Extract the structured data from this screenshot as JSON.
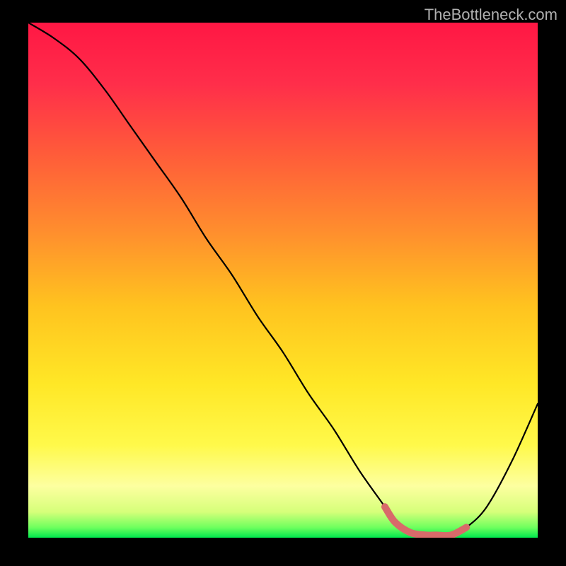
{
  "watermark": "TheBottleneck.com",
  "chart_data": {
    "type": "line",
    "title": "",
    "xlabel": "",
    "ylabel": "",
    "xlim": [
      0,
      100
    ],
    "ylim": [
      0,
      100
    ],
    "series": [
      {
        "name": "bottleneck-curve",
        "x": [
          0,
          5,
          10,
          15,
          20,
          25,
          30,
          35,
          40,
          45,
          50,
          55,
          60,
          65,
          70,
          72,
          75,
          78,
          80,
          83,
          86,
          90,
          95,
          100
        ],
        "y": [
          100,
          97,
          93,
          87,
          80,
          73,
          66,
          58,
          51,
          43,
          36,
          28,
          21,
          13,
          6,
          3,
          1,
          0.5,
          0.5,
          0.5,
          2,
          6,
          15,
          26
        ],
        "color": "#000000"
      },
      {
        "name": "sweet-spot-highlight",
        "x": [
          70,
          72,
          75,
          78,
          80,
          83,
          86
        ],
        "y": [
          6,
          3,
          1,
          0.5,
          0.5,
          0.5,
          2
        ],
        "color": "#d86a6a"
      }
    ],
    "gradient_stops": [
      {
        "offset": 0,
        "color": "#ff1744"
      },
      {
        "offset": 12,
        "color": "#ff2e4a"
      },
      {
        "offset": 25,
        "color": "#ff5a3a"
      },
      {
        "offset": 40,
        "color": "#ff8c2e"
      },
      {
        "offset": 55,
        "color": "#ffc31f"
      },
      {
        "offset": 70,
        "color": "#ffe726"
      },
      {
        "offset": 82,
        "color": "#fff94a"
      },
      {
        "offset": 90,
        "color": "#fdffa0"
      },
      {
        "offset": 95,
        "color": "#d6ff7a"
      },
      {
        "offset": 98,
        "color": "#6fff5e"
      },
      {
        "offset": 100,
        "color": "#00e84e"
      }
    ]
  }
}
